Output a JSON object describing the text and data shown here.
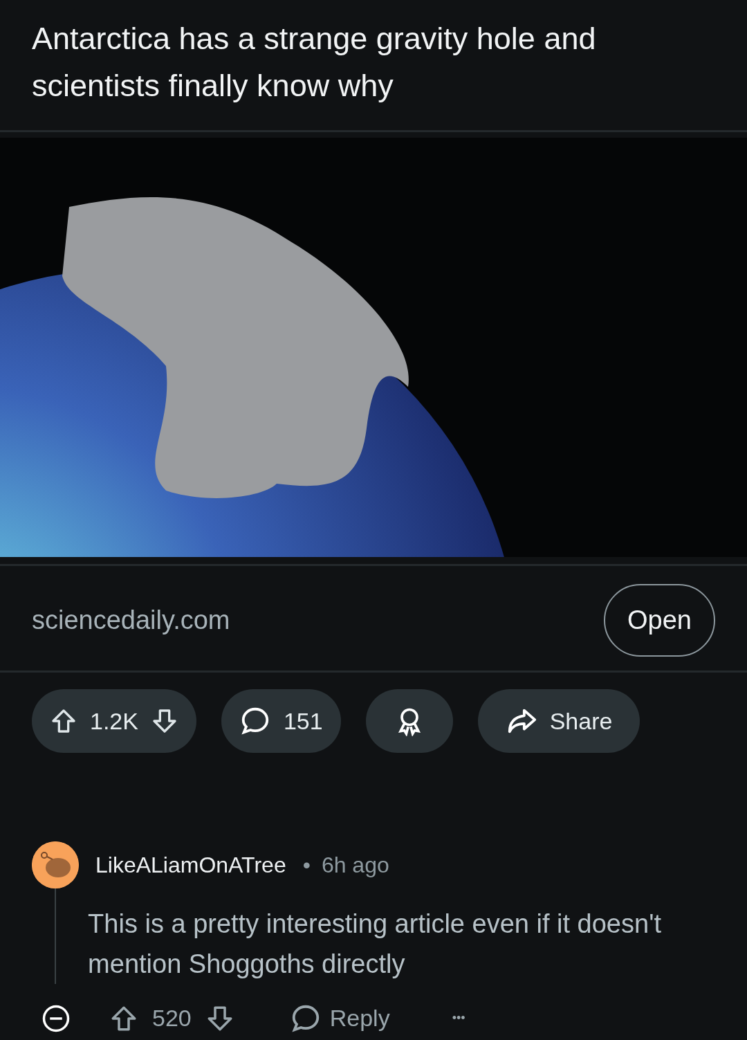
{
  "post": {
    "title": "Antarctica has a strange gravity hole and scientists finally know why",
    "link": {
      "domain": "sciencedaily.com",
      "button": "Open"
    },
    "actions": {
      "score": "1.2K",
      "comments": "151",
      "share": "Share"
    }
  },
  "comment": {
    "author": "LikeALiamOnATree",
    "separator": "•",
    "time": "6h ago",
    "body": "This is a pretty interesting article even if it doesn't mention Shoggoths directly",
    "score": "520",
    "reply": "Reply",
    "more": "•••"
  }
}
